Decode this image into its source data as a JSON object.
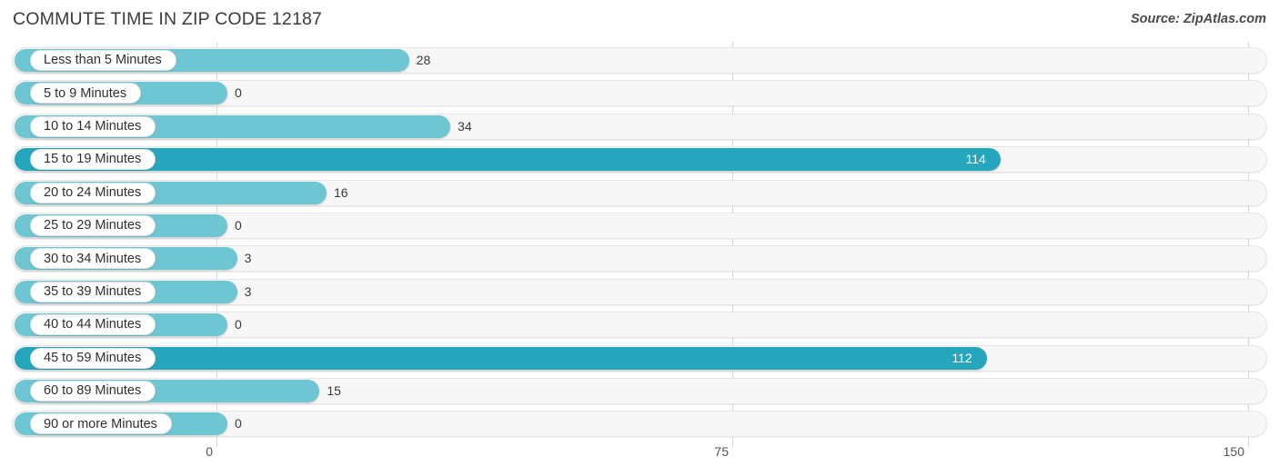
{
  "header": {
    "title": "COMMUTE TIME IN ZIP CODE 12187",
    "source": "Source: ZipAtlas.com"
  },
  "colors": {
    "bar_light": "#6ec6d2",
    "bar_dark": "#26a6bd",
    "track": "#f7f7f7",
    "track_border": "#e6e6e6",
    "gridline": "#d8d8d8",
    "text": "#3c3c3c",
    "value_inside": "#ffffff"
  },
  "chart_data": {
    "type": "bar",
    "orientation": "horizontal",
    "title": "COMMUTE TIME IN ZIP CODE 12187",
    "xlabel": "",
    "ylabel": "",
    "xlim": [
      0,
      150
    ],
    "ticks": [
      "0",
      "75",
      "150"
    ],
    "tick_values": [
      0,
      75,
      150
    ],
    "grid": true,
    "legend": null,
    "categories": [
      "Less than 5 Minutes",
      "5 to 9 Minutes",
      "10 to 14 Minutes",
      "15 to 19 Minutes",
      "20 to 24 Minutes",
      "25 to 29 Minutes",
      "30 to 34 Minutes",
      "35 to 39 Minutes",
      "40 to 44 Minutes",
      "45 to 59 Minutes",
      "60 to 89 Minutes",
      "90 or more Minutes"
    ],
    "values": [
      28,
      0,
      34,
      114,
      16,
      0,
      3,
      3,
      0,
      112,
      15,
      0
    ],
    "value_labels": [
      "28",
      "0",
      "34",
      "114",
      "16",
      "0",
      "3",
      "3",
      "0",
      "112",
      "15",
      "0"
    ],
    "bars": [
      {
        "label": "Less than 5 Minutes",
        "value": 28,
        "value_label": "28",
        "highlight": false
      },
      {
        "label": "5 to 9 Minutes",
        "value": 0,
        "value_label": "0",
        "highlight": false
      },
      {
        "label": "10 to 14 Minutes",
        "value": 34,
        "value_label": "34",
        "highlight": false
      },
      {
        "label": "15 to 19 Minutes",
        "value": 114,
        "value_label": "114",
        "highlight": true
      },
      {
        "label": "20 to 24 Minutes",
        "value": 16,
        "value_label": "16",
        "highlight": false
      },
      {
        "label": "25 to 29 Minutes",
        "value": 0,
        "value_label": "0",
        "highlight": false
      },
      {
        "label": "30 to 34 Minutes",
        "value": 3,
        "value_label": "3",
        "highlight": false
      },
      {
        "label": "35 to 39 Minutes",
        "value": 3,
        "value_label": "3",
        "highlight": false
      },
      {
        "label": "40 to 44 Minutes",
        "value": 0,
        "value_label": "0",
        "highlight": false
      },
      {
        "label": "45 to 59 Minutes",
        "value": 112,
        "value_label": "112",
        "highlight": true
      },
      {
        "label": "60 to 89 Minutes",
        "value": 15,
        "value_label": "15",
        "highlight": false
      },
      {
        "label": "90 or more Minutes",
        "value": 0,
        "value_label": "0",
        "highlight": false
      }
    ]
  }
}
